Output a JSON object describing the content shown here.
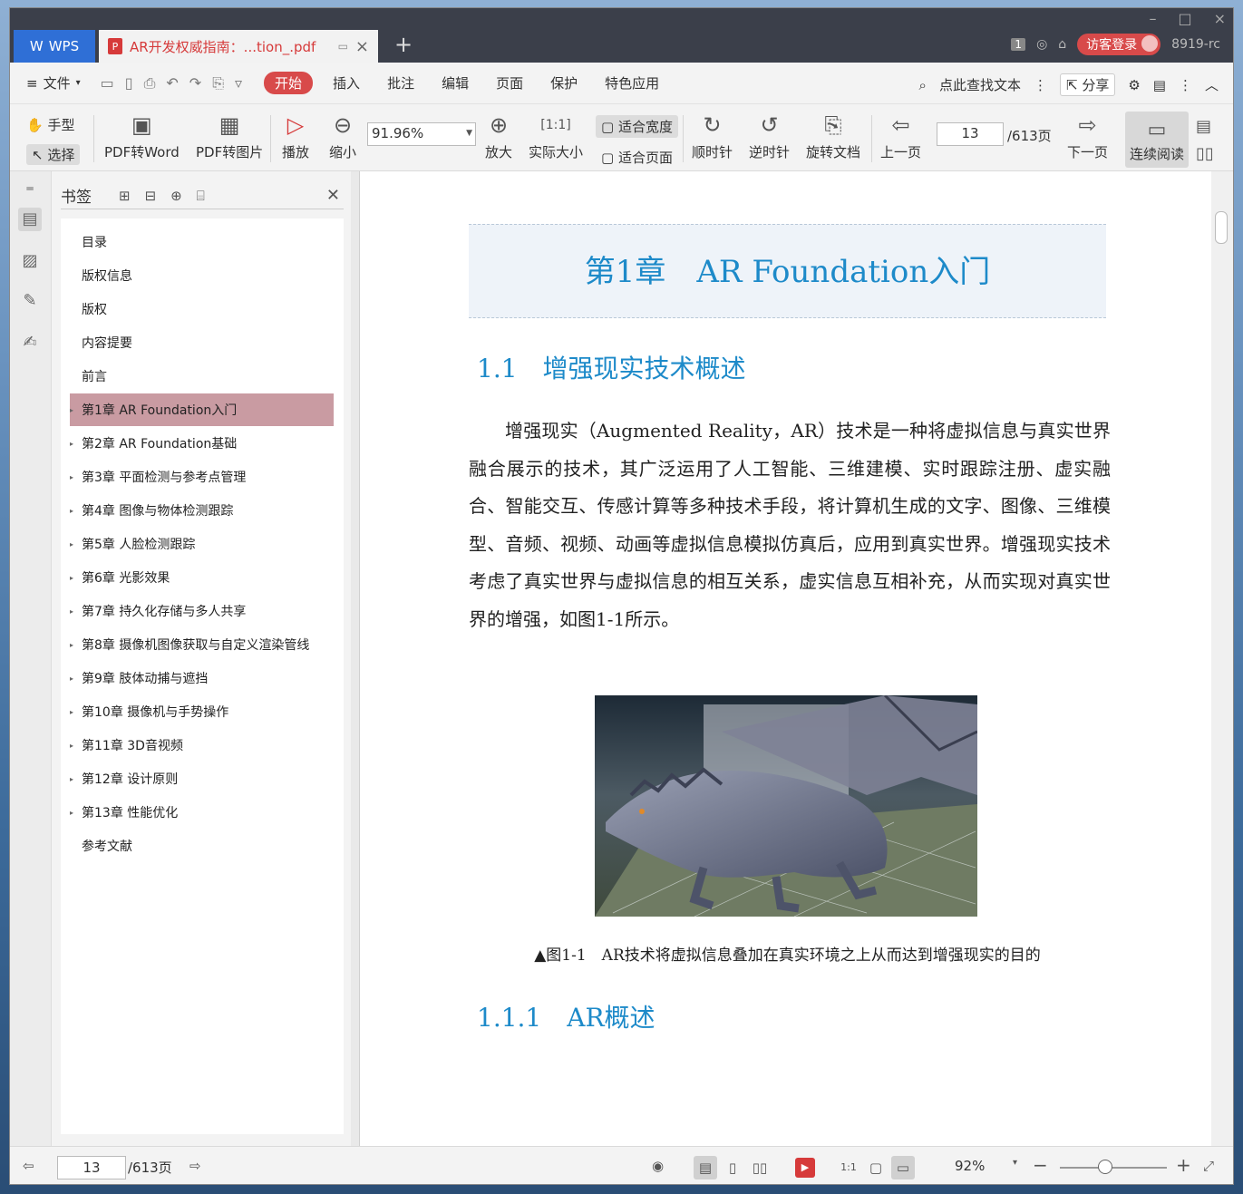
{
  "window": {
    "app_tab": "WPS",
    "doc_tab": "AR开发权威指南：...tion_.pdf",
    "visitor_login": "访客登录",
    "version": "8919-rc",
    "count_badge": "1"
  },
  "menu": {
    "file": "文件",
    "tabs": [
      "开始",
      "插入",
      "批注",
      "编辑",
      "页面",
      "保护",
      "特色应用"
    ],
    "search": "点此查找文本",
    "share": "分享"
  },
  "toolbar": {
    "hand": "手型",
    "select": "选择",
    "pdf_to_word": "PDF转Word",
    "pdf_to_image": "PDF转图片",
    "play": "播放",
    "zoom_out": "缩小",
    "zoom_value": "91.96%",
    "zoom_in": "放大",
    "actual_size": "实际大小",
    "fit_width": "适合宽度",
    "fit_page": "适合页面",
    "clockwise": "顺时针",
    "counterclockwise": "逆时针",
    "rotate_doc": "旋转文档",
    "prev_page": "上一页",
    "current_page": "13",
    "page_total": "/613页",
    "next_page": "下一页",
    "continuous_read": "连续阅读"
  },
  "bookmarks": {
    "title": "书签",
    "items": [
      {
        "label": "目录",
        "expandable": false
      },
      {
        "label": "版权信息",
        "expandable": false
      },
      {
        "label": "版权",
        "expandable": false
      },
      {
        "label": "内容提要",
        "expandable": false
      },
      {
        "label": "前言",
        "expandable": false
      },
      {
        "label": "第1章 AR Foundation入门",
        "expandable": true,
        "selected": true
      },
      {
        "label": "第2章 AR Foundation基础",
        "expandable": true
      },
      {
        "label": "第3章 平面检测与参考点管理",
        "expandable": true
      },
      {
        "label": "第4章 图像与物体检测跟踪",
        "expandable": true
      },
      {
        "label": "第5章 人脸检测跟踪",
        "expandable": true
      },
      {
        "label": "第6章 光影效果",
        "expandable": true
      },
      {
        "label": "第7章 持久化存储与多人共享",
        "expandable": true
      },
      {
        "label": "第8章 摄像机图像获取与自定义渲染管线",
        "expandable": true
      },
      {
        "label": "第9章 肢体动捕与遮挡",
        "expandable": true
      },
      {
        "label": "第10章 摄像机与手势操作",
        "expandable": true
      },
      {
        "label": "第11章 3D音视频",
        "expandable": true
      },
      {
        "label": "第12章 设计原则",
        "expandable": true
      },
      {
        "label": "第13章 性能优化",
        "expandable": true
      },
      {
        "label": "参考文献",
        "expandable": false
      }
    ]
  },
  "document": {
    "chapter_title": "第1章　AR Foundation入门",
    "section_title": "1.1　增强现实技术概述",
    "paragraph": "增强现实（Augmented Reality，AR）技术是一种将虚拟信息与真实世界融合展示的技术，其广泛运用了人工智能、三维建模、实时跟踪注册、虚实融合、智能交互、传感计算等多种技术手段，将计算机生成的文字、图像、三维模型、音频、视频、动画等虚拟信息模拟仿真后，应用到真实世界。增强现实技术考虑了真实世界与虚拟信息的相互关系，虚实信息互相补充，从而实现对真实世界的增强，如图1-1所示。",
    "figure_caption": "▲图1-1　AR技术将虚拟信息叠加在真实环境之上从而达到增强现实的目的",
    "subsection_title": "1.1.1　AR概述"
  },
  "statusbar": {
    "page": "13",
    "page_total": "/613页",
    "zoom": "92%",
    "zoom_level": 0.42
  },
  "colors": {
    "accent_red": "#d84a4a",
    "heading_blue": "#1d8ac9",
    "bookmark_selected": "#c99ba2"
  }
}
